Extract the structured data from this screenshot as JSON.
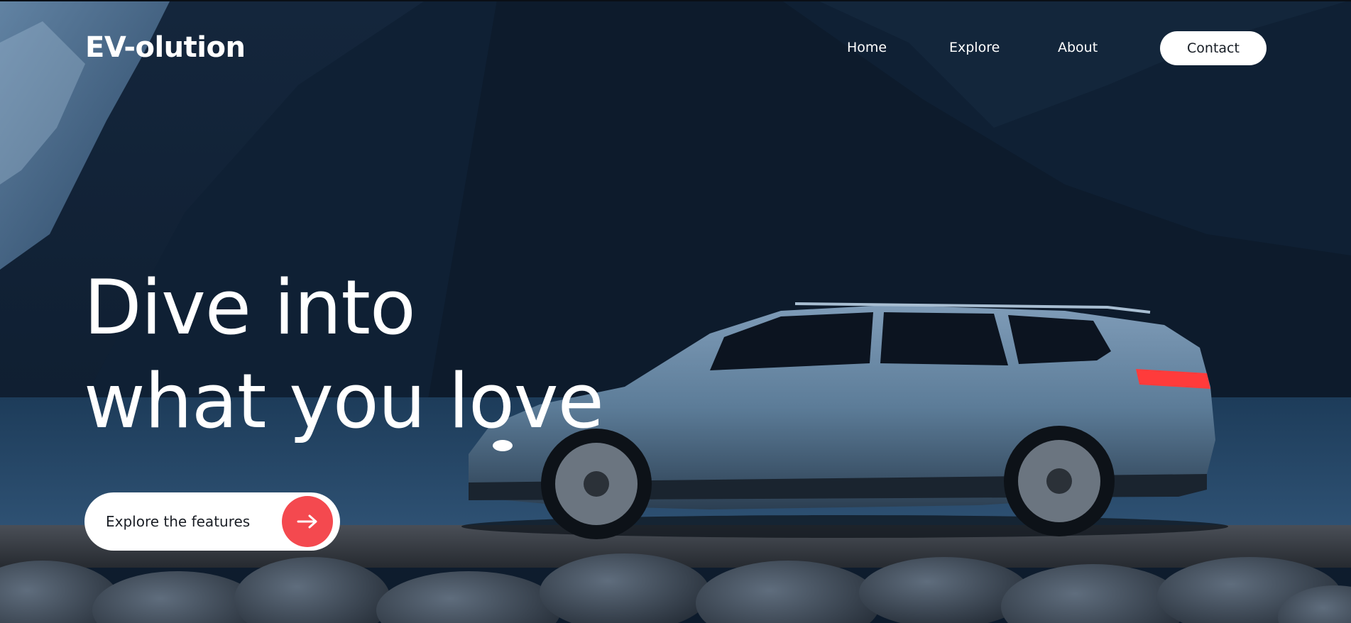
{
  "header": {
    "logo": "EV-olution",
    "nav": {
      "home": "Home",
      "explore": "Explore",
      "about": "About",
      "contact": "Contact"
    }
  },
  "hero": {
    "headline_line1": "Dive into",
    "headline_line2": "what you love",
    "cta_label": "Explore the features",
    "cta_icon": "arrow-right-icon",
    "background": "mountain-lake-electric-car-photo"
  },
  "colors": {
    "accent": "#f4494f",
    "button_bg": "#ffffff",
    "text": "#ffffff"
  }
}
